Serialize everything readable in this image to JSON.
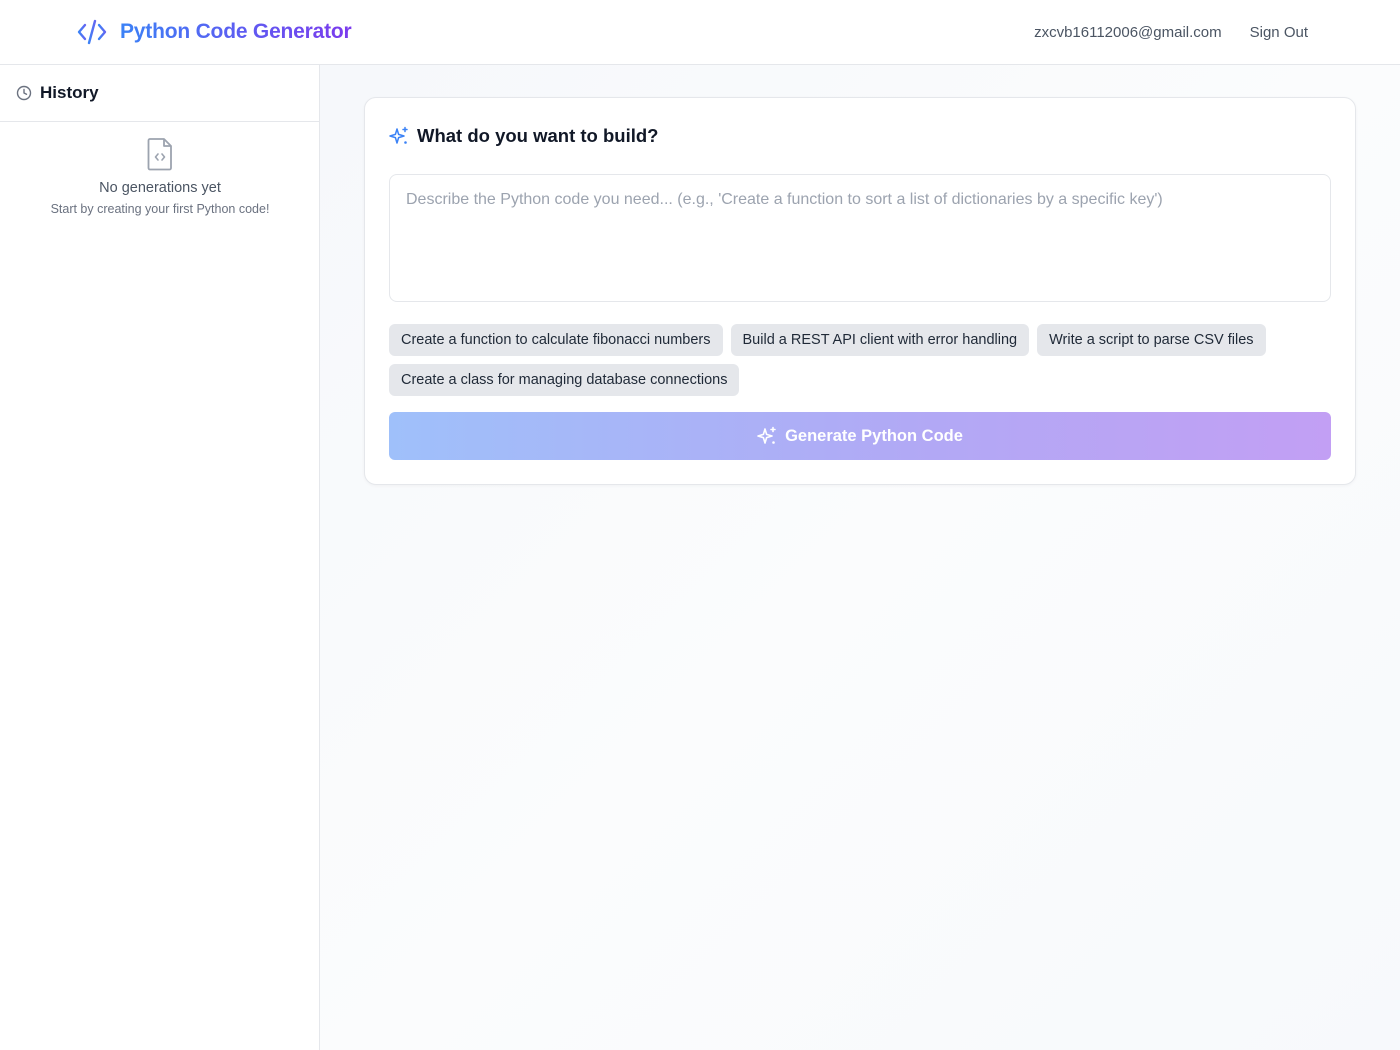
{
  "header": {
    "brand_title": "Python Code Generator",
    "brand_icon": "code-icon",
    "user_email": "zxcvb16112006@gmail.com",
    "sign_out_label": "Sign Out"
  },
  "sidebar": {
    "title": "History",
    "title_icon": "clock-icon",
    "empty_icon": "file-code-icon",
    "empty_title": "No generations yet",
    "empty_subtitle": "Start by creating your first Python code!"
  },
  "main": {
    "card_title": "What do you want to build?",
    "card_icon": "sparkles-icon",
    "prompt": {
      "value": "",
      "placeholder": "Describe the Python code you need... (e.g., 'Create a function to sort a list of dictionaries by a specific key')"
    },
    "suggestions": [
      "Create a function to calculate fibonacci numbers",
      "Build a REST API client with error handling",
      "Write a script to parse CSV files",
      "Create a class for managing database connections"
    ],
    "generate_label": "Generate Python Code",
    "generate_icon": "sparkles-icon"
  },
  "colors": {
    "brand_gradient_start": "#3b82f6",
    "brand_gradient_end": "#7c3aed",
    "button_gradient_start": "#9fc0fa",
    "button_gradient_end": "#c29ff4",
    "chip_bg": "#e5e7eb",
    "border": "#e5e7eb"
  }
}
